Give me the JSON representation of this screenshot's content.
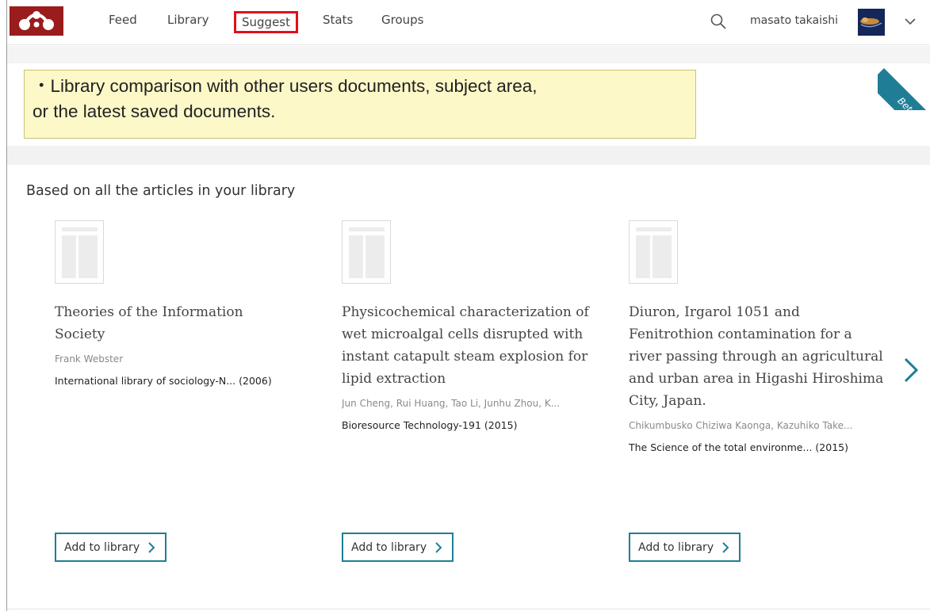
{
  "nav": {
    "items": [
      "Feed",
      "Library",
      "Suggest",
      "Stats",
      "Groups"
    ],
    "active": "Suggest",
    "user_name": "masato takaishi"
  },
  "callout": {
    "line1": "・Library comparison with other users documents, subject area,",
    "line2": "or the latest saved documents."
  },
  "beta_label": "Beta",
  "section_title": "Based on all the articles in your library",
  "cards": [
    {
      "title": "Theories of the Information Society",
      "authors": "Frank Webster",
      "publication": "International library of sociology-N...",
      "year": "(2006)",
      "button": "Add to library"
    },
    {
      "title": "Physicochemical characterization of wet microalgal cells disrupted with instant catapult steam explosion for lipid extraction",
      "authors": "Jun Cheng, Rui Huang, Tao Li, Junhu Zhou, K...",
      "publication": "Bioresource Technology-191",
      "year": "(2015)",
      "button": "Add to library"
    },
    {
      "title": "Diuron, Irgarol 1051 and Fenitrothion contamination for a river passing through an agricultural and urban area in Higashi Hiroshima City, Japan.",
      "authors": "Chikumbusko Chiziwa Kaonga, Kazuhiko Take...",
      "publication": "The Science of the total environme...",
      "year": "(2015)",
      "button": "Add to library"
    }
  ],
  "icons": {
    "logo": "mendeley-logo",
    "search": "search-icon",
    "menu": "chevron-down-icon",
    "next": "chevron-right-icon"
  },
  "colors": {
    "brand": "#9b1c1c",
    "accent": "#1f7e96",
    "highlight": "#e0101a",
    "callout_bg": "#fcf8c8"
  }
}
